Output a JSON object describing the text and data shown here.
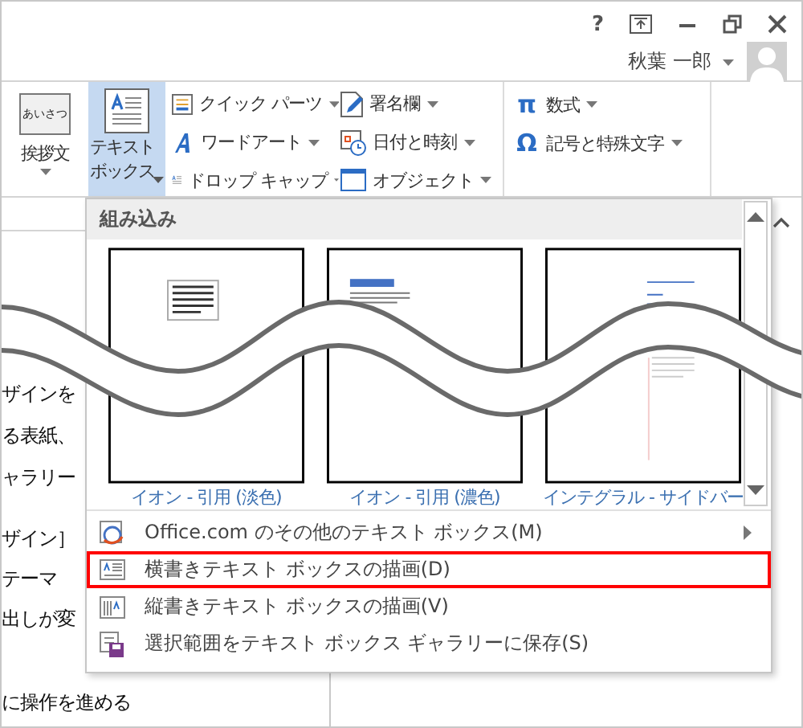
{
  "title_bar": {
    "help": "?",
    "user_name": "秋葉 一郎"
  },
  "ribbon": {
    "greeting": {
      "icon_text": "あいさつ",
      "label": "挨拶文",
      "selected": false
    },
    "text_box": {
      "label_lines": [
        "テキスト",
        "ボックス"
      ],
      "selected": true
    },
    "column_1": [
      {
        "label": "クイック パーツ"
      },
      {
        "label": "ワードアート"
      },
      {
        "label": "ドロップ キャップ"
      }
    ],
    "column_2": [
      {
        "label": "署名欄"
      },
      {
        "label": "日付と時刻"
      },
      {
        "label": "オブジェクト"
      }
    ],
    "column_3": [
      {
        "label": "数式",
        "symbol": "π"
      },
      {
        "label": "記号と特殊文字",
        "symbol": "Ω"
      }
    ]
  },
  "document": {
    "lines": [
      "ザインを",
      "る表紙、",
      "ャラリー",
      "ザイン］",
      "テーマ",
      "出しが変",
      "に操作を進める"
    ]
  },
  "menu": {
    "section": "組み込み",
    "gallery": [
      {
        "label": "イオン - 引用 (淡色)"
      },
      {
        "label": "イオン - 引用 (濃色)"
      },
      {
        "label": "インテグラル - サイドバー"
      }
    ],
    "items": [
      {
        "label": "Office.com のその他のテキスト ボックス(M)",
        "submenu": true,
        "highlighted": false
      },
      {
        "label": "横書きテキスト ボックスの描画(D)",
        "submenu": false,
        "highlighted": true
      },
      {
        "label": "縦書きテキスト ボックスの描画(V)",
        "submenu": false,
        "highlighted": false
      },
      {
        "label": "選択範囲をテキスト ボックス ギャラリーに保存(S)",
        "submenu": false,
        "highlighted": false
      }
    ]
  }
}
